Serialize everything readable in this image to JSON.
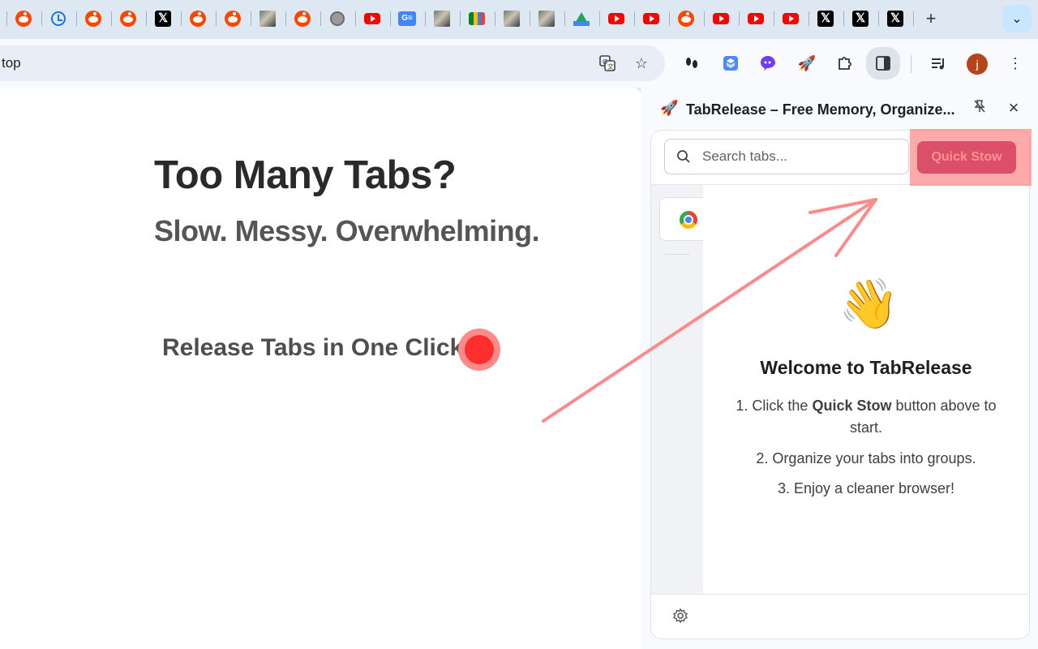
{
  "tabs": [
    {
      "icon": "reddit-icon"
    },
    {
      "icon": "history-icon"
    },
    {
      "icon": "reddit-icon"
    },
    {
      "icon": "reddit-icon"
    },
    {
      "icon": "x-icon"
    },
    {
      "icon": "reddit-icon"
    },
    {
      "icon": "reddit-icon"
    },
    {
      "icon": "photo-icon"
    },
    {
      "icon": "reddit-icon"
    },
    {
      "icon": "globe-icon"
    },
    {
      "icon": "youtube-icon"
    },
    {
      "icon": "google-news-icon"
    },
    {
      "icon": "photo-icon"
    },
    {
      "icon": "google-meet-icon"
    },
    {
      "icon": "photo-icon"
    },
    {
      "icon": "photo-icon"
    },
    {
      "icon": "google-drive-icon"
    },
    {
      "icon": "youtube-icon"
    },
    {
      "icon": "youtube-icon"
    },
    {
      "icon": "reddit-icon"
    },
    {
      "icon": "youtube-icon"
    },
    {
      "icon": "youtube-icon"
    },
    {
      "icon": "youtube-icon"
    },
    {
      "icon": "x-icon"
    },
    {
      "icon": "x-icon"
    },
    {
      "icon": "x-icon"
    }
  ],
  "toolbar": {
    "omnibox_text": "top",
    "avatar_letter": "j"
  },
  "page": {
    "headline": "Too Many Tabs?",
    "subhead": "Slow. Messy. Overwhelming.",
    "cta": "Release Tabs in One Click"
  },
  "sidepanel": {
    "title": "TabRelease – Free Memory, Organize...",
    "search_placeholder": "Search tabs...",
    "quick_stow_label": "Quick Stow",
    "welcome_emoji": "👋",
    "welcome_title": "Welcome to TabRelease",
    "step1_prefix": "1. Click the ",
    "step1_bold": "Quick Stow",
    "step1_suffix": " button above to start.",
    "step2": "2. Organize your tabs into groups.",
    "step3": "3. Enjoy a cleaner browser!"
  },
  "colors": {
    "accent": "#b0376e",
    "accent_text": "#ffc9c9",
    "annotation": "#ff8a8a",
    "cta_dot": "#ff2e2e"
  }
}
